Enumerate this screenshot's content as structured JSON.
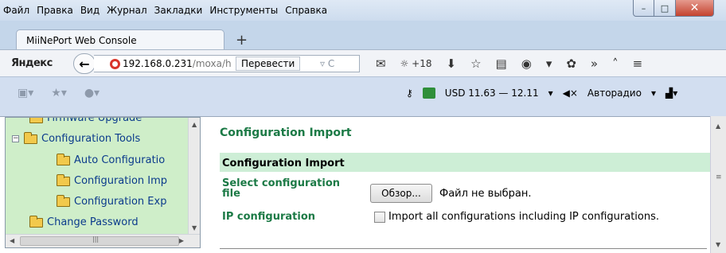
{
  "menubar": {
    "items": [
      "Файл",
      "Правка",
      "Вид",
      "Журнал",
      "Закладки",
      "Инструменты",
      "Справка"
    ]
  },
  "window_controls": {
    "minimize": "–",
    "maximize": "□",
    "close": "✕"
  },
  "tab": {
    "title": "MiiNePort Web Console",
    "new_tab": "+"
  },
  "navbar": {
    "brand": "Яндекс",
    "back": "←",
    "url_host": "192.168.0.231",
    "url_path": "/moxa/h",
    "translate_label": "Перевести",
    "url_arrows": "▿ C",
    "weather": "+18",
    "more": "»"
  },
  "bookmarks": {
    "currency": "USD 11.63 — 12.11",
    "radio": "Авторадио"
  },
  "tree": {
    "items": [
      {
        "label": "Firmware Upgrade",
        "level": 1
      },
      {
        "label": "Configuration Tools",
        "level": 0,
        "expander": "−"
      },
      {
        "label": "Auto Configuratio",
        "level": 1
      },
      {
        "label": "Configuration Imp",
        "level": 1
      },
      {
        "label": "Configuration Exp",
        "level": 1
      },
      {
        "label": "Change Password",
        "level": 0
      }
    ]
  },
  "main": {
    "page_title": "Configuration Import",
    "section_title": "Configuration Import",
    "select_label": "Select configuration file",
    "browse_button": "Обзор...",
    "no_file": "Файл не выбран.",
    "ip_label": "IP configuration",
    "ip_checkbox_label": "Import all configurations including IP configurations.",
    "ip_checkbox_checked": false
  },
  "colors": {
    "tree_bg": "#cfeec9",
    "section_bg": "#cdeed6",
    "label_green": "#1c7a46",
    "tree_link": "#0b3b8c"
  }
}
